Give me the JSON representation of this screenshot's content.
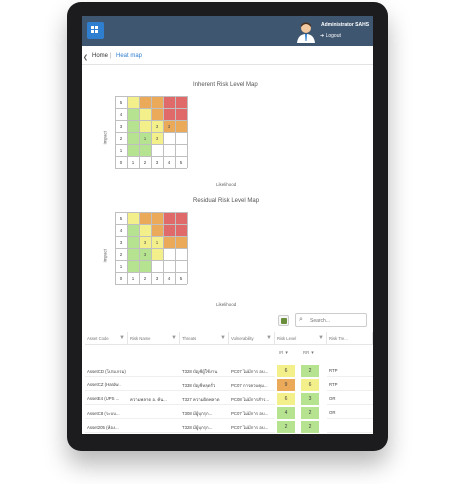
{
  "header": {
    "user_name": "Administrator SAHS",
    "logout_label": "Logout",
    "logout_arrow": "➜"
  },
  "breadcrumb": {
    "arrow": "❮",
    "home": "Home",
    "separator": "|",
    "current": "Heat map"
  },
  "inherent_map": {
    "title": "Inherent Risk Level Map",
    "ylabel": "Impact",
    "xlabel": "Likelihood",
    "y_ticks": [
      "5",
      "4",
      "3",
      "2",
      "1",
      "0"
    ],
    "x_ticks": [
      "1",
      "2",
      "3",
      "4",
      "5"
    ],
    "cell_counts": {
      "r3c3": "3",
      "r3c4": "3",
      "r2c2": "1",
      "r2c3": "3"
    }
  },
  "residual_map": {
    "title": "Residual Risk Level Map",
    "ylabel": "Impact",
    "xlabel": "Likelihood",
    "y_ticks": [
      "5",
      "4",
      "3",
      "2",
      "1",
      "0"
    ],
    "x_ticks": [
      "1",
      "2",
      "3",
      "4",
      "5"
    ],
    "cell_counts": {
      "r3c2": "3",
      "r3c3": "1",
      "r2c2": "3"
    }
  },
  "colors": {
    "green": "#b6e38f",
    "yellow": "#f3ef8a",
    "orange": "#ebaa5a",
    "red": "#e06a6a",
    "topbar": "#3e5670",
    "accent": "#2f7fd0"
  },
  "toolbar": {
    "search_placeholder": "Search...",
    "search_icon": "⌕",
    "export_icon": "excel-export-icon"
  },
  "table": {
    "columns": [
      "Asset Code",
      "Risk Name",
      "Threats",
      "Vulnerability",
      "Risk Level",
      "Risk Tre..."
    ],
    "risk_level_sub": [
      "IR",
      "RR"
    ],
    "filter_glyph": "▼",
    "rows": [
      {
        "code": "AssetCD (โปรแกรม)",
        "risk": "",
        "threat": "T328 บัญชีผู้ใช้งาน",
        "vuln": "PC07 ไม่มีการ อบ...",
        "ir": "6",
        "rr": "2",
        "treat": "RTP"
      },
      {
        "code": "AssetCZ (Hardw..",
        "risk": "",
        "threat": "T338 บัญชีหลุดรั่ว",
        "vuln": "PC07 การควบคุม...",
        "ir": "9",
        "rr": "6",
        "treat": "RTP"
      },
      {
        "code": "AssetE4 (UPS ...",
        "risk": "ความพลาด อ. ค้น...",
        "threat": "T327 ความผิดพลาด",
        "vuln": "PC08 ไม่มีการสำร...",
        "ir": "6",
        "rr": "3",
        "treat": "OR"
      },
      {
        "code": "AssetC8 (ระบบ...",
        "risk": "",
        "threat": "T308 มีผู้บุกรุก...",
        "vuln": "PC07 ไม่มีการ อบ...",
        "ir": "4",
        "rr": "2",
        "treat": "OR"
      },
      {
        "code": "Asset205 (ห้อง...",
        "risk": "",
        "threat": "T328 มีผู้บุกรุก...",
        "vuln": "PC07 ไม่มีการ อบ...",
        "ir": "2",
        "rr": "2",
        "treat": ""
      }
    ]
  }
}
